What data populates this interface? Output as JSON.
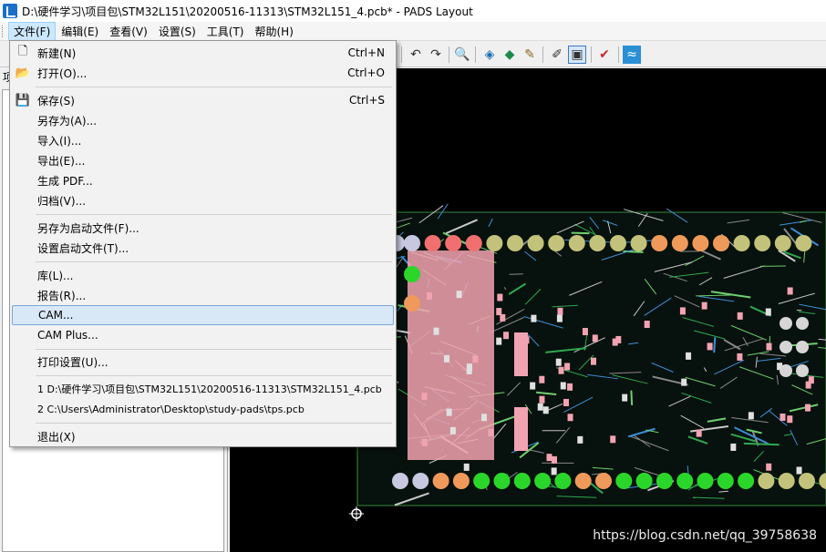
{
  "window": {
    "title": "D:\\硬件学习\\项目包\\STM32L151\\20200516-11313\\STM32L151_4.pcb* - PADS Layout"
  },
  "menubar": [
    "文件(F)",
    "编辑(E)",
    "查看(V)",
    "设置(S)",
    "工具(T)",
    "帮助(H)"
  ],
  "left_panel": {
    "tab": "项"
  },
  "file_menu": {
    "items": [
      {
        "label": "新建(N)",
        "shortcut": "Ctrl+N",
        "icon": "new-file-icon"
      },
      {
        "label": "打开(O)...",
        "shortcut": "Ctrl+O",
        "icon": "open-folder-icon"
      },
      {
        "label": "保存(S)",
        "shortcut": "Ctrl+S",
        "icon": "save-icon"
      },
      {
        "label": "另存为(A)...",
        "shortcut": ""
      },
      {
        "label": "导入(I)...",
        "shortcut": ""
      },
      {
        "label": "导出(E)...",
        "shortcut": ""
      },
      {
        "label": "生成 PDF...",
        "shortcut": ""
      },
      {
        "label": "归档(V)...",
        "shortcut": ""
      },
      {
        "label": "另存为启动文件(F)...",
        "shortcut": ""
      },
      {
        "label": "设置启动文件(T)...",
        "shortcut": ""
      },
      {
        "label": "库(L)...",
        "shortcut": ""
      },
      {
        "label": "报告(R)...",
        "shortcut": ""
      },
      {
        "label": "CAM...",
        "shortcut": ""
      },
      {
        "label": "CAM Plus...",
        "shortcut": ""
      },
      {
        "label": "打印设置(U)...",
        "shortcut": ""
      },
      {
        "label": "1 D:\\硬件学习\\项目包\\STM32L151\\20200516-11313\\STM32L151_4.pcb",
        "shortcut": ""
      },
      {
        "label": "2 C:\\Users\\Administrator\\Desktop\\study-pads\\tps.pcb",
        "shortcut": ""
      },
      {
        "label": "退出(X)",
        "shortcut": ""
      }
    ],
    "highlighted": "CAM..."
  },
  "toolbar": {
    "icons": [
      "undo-icon",
      "redo-icon",
      "zoom-icon",
      "select-icon",
      "select-alt-icon",
      "brush-icon",
      "edit-icon",
      "view-icon",
      "drc-icon",
      "route-icon"
    ]
  },
  "watermark": "https://blog.csdn.net/qq_39758638",
  "colors": {
    "menu_highlight": "#d9e8f7",
    "pcb_background": "#000000",
    "pad_green": "#2bd62b",
    "pad_yellow": "#c2c27a",
    "pad_orange": "#ef9a5a"
  }
}
